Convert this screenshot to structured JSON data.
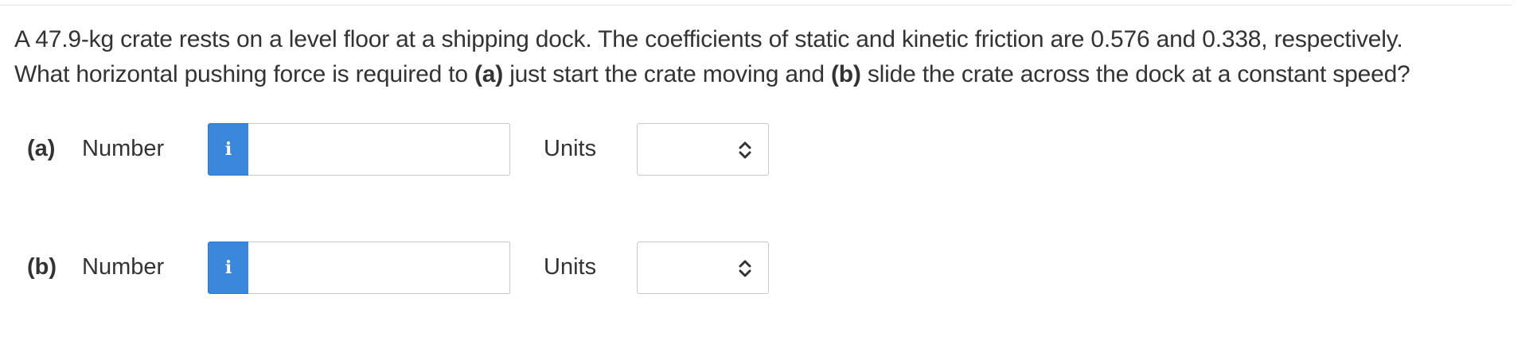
{
  "question": {
    "line1": "A 47.9-kg crate rests on a level floor at a shipping dock. The coefficients of static and kinetic friction are 0.576 and 0.338, respectively.",
    "line2_pre": "What horizontal pushing force is required to ",
    "line2_a": "(a)",
    "line2_mid": " just start the crate moving and ",
    "line2_b": "(b)",
    "line2_post": " slide the crate across the dock at a constant speed?"
  },
  "answers": [
    {
      "part_label": "(a)",
      "number_label": "Number",
      "number_value": "",
      "info_icon": "info-icon",
      "units_label": "Units",
      "units_selected": ""
    },
    {
      "part_label": "(b)",
      "number_label": "Number",
      "number_value": "",
      "info_icon": "info-icon",
      "units_label": "Units",
      "units_selected": ""
    }
  ],
  "colors": {
    "info_button": "#3a87dc",
    "text": "#333333",
    "border": "#c8c8c8"
  }
}
